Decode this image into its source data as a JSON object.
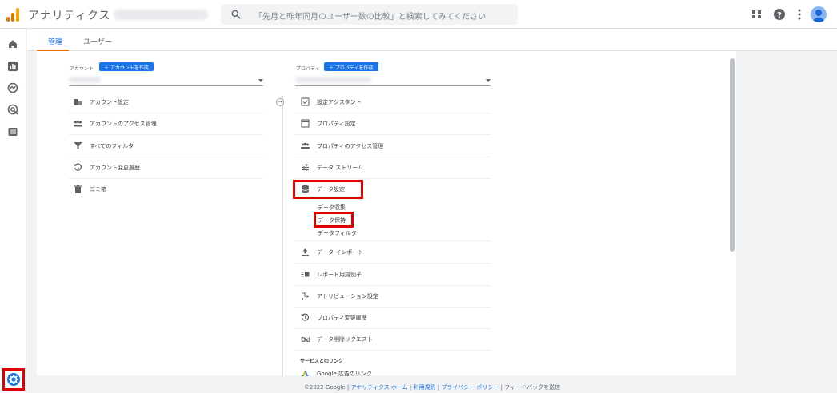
{
  "header": {
    "app_title": "アナリティクス",
    "search_placeholder": "「先月と昨年同月のユーザー数の比較」と検索してみてください"
  },
  "tabs": [
    {
      "label": "管理",
      "active": true
    },
    {
      "label": "ユーザー",
      "active": false
    }
  ],
  "account": {
    "label": "アカウント",
    "create_button": "アカウントを作成",
    "items": [
      {
        "label": "アカウント設定",
        "icon": "building-icon"
      },
      {
        "label": "アカウントのアクセス管理",
        "icon": "people-icon"
      },
      {
        "label": "すべてのフィルタ",
        "icon": "filter-icon"
      },
      {
        "label": "アカウント変更履歴",
        "icon": "history-icon"
      },
      {
        "label": "ゴミ箱",
        "icon": "trash-icon"
      }
    ]
  },
  "property": {
    "label": "プロパティ",
    "create_button": "プロパティを作成",
    "items": [
      {
        "label": "設定アシスタント",
        "icon": "checkbox-icon"
      },
      {
        "label": "プロパティ設定",
        "icon": "window-icon"
      },
      {
        "label": "プロパティのアクセス管理",
        "icon": "people-icon"
      },
      {
        "label": "データ ストリーム",
        "icon": "streams-icon"
      },
      {
        "label": "データ設定",
        "icon": "database-icon"
      }
    ],
    "data_settings_sub": [
      "データ収集",
      "データ保持",
      "データフィルタ"
    ],
    "items2": [
      {
        "label": "データ インポート",
        "icon": "upload-icon"
      },
      {
        "label": "レポート用識別子",
        "icon": "identity-icon"
      },
      {
        "label": "アトリビューション設定",
        "icon": "attribution-icon"
      },
      {
        "label": "プロパティ変更履歴",
        "icon": "history-icon"
      },
      {
        "label": "データ削除リクエスト",
        "icon": "dd-icon"
      }
    ],
    "links_section": "サービスとのリンク",
    "links": [
      {
        "label": "Google 広告のリンク",
        "icon": "google-ads-icon"
      }
    ]
  },
  "footer": {
    "copyright": "©2022 Google",
    "links": [
      "アナリティクス ホーム",
      "利用規約",
      "プライバシー ポリシー"
    ],
    "feedback": "フィードバックを送信"
  },
  "colors": {
    "accent": "#1a73e8",
    "highlight": "#e00000",
    "brand": "#e37400"
  }
}
